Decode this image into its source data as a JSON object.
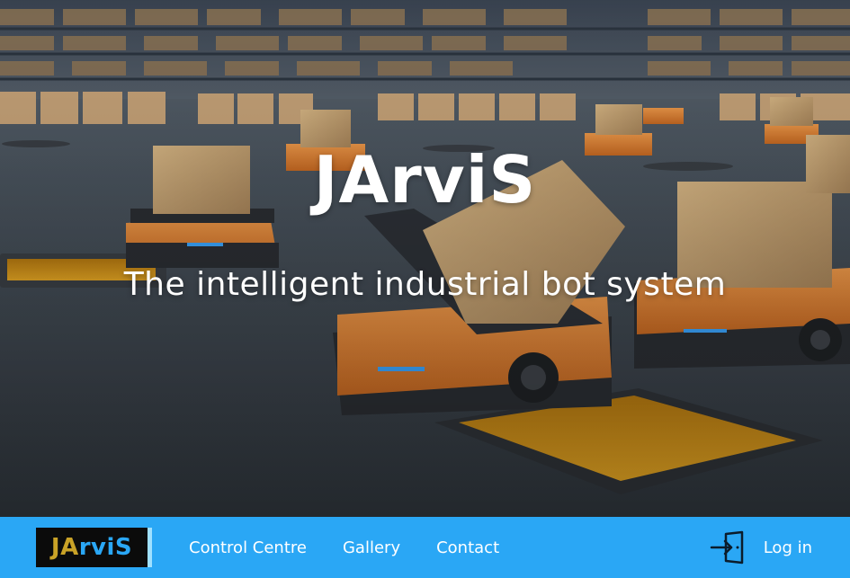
{
  "hero": {
    "title": "JArviS",
    "subtitle": "The intelligent industrial bot system",
    "background_icon": "warehouse-robots-photo"
  },
  "navbar": {
    "background_color": "#2aa7f5",
    "brand": {
      "text_first": "JA",
      "text_rest": "rviS",
      "first_color": "#c9a227",
      "rest_color": "#2aa7f5"
    },
    "links": [
      {
        "label": "Control Centre"
      },
      {
        "label": "Gallery"
      },
      {
        "label": "Contact"
      }
    ],
    "login": {
      "label": "Log in",
      "icon": "login-icon"
    }
  }
}
